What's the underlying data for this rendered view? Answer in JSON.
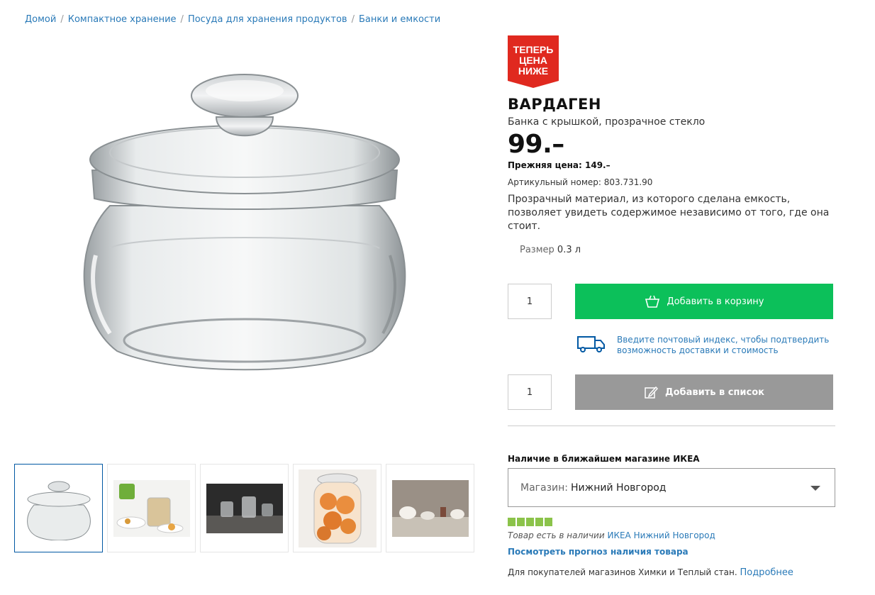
{
  "breadcrumb": [
    "Домой",
    "Компактное хранение",
    "Посуда для хранения продуктов",
    "Банки и емкости"
  ],
  "badge": {
    "line1": "ТЕПЕРЬ",
    "line2": "ЦЕНА",
    "line3": "НИЖЕ",
    "color": "#e0291f"
  },
  "product": {
    "name": "ВАРДАГЕН",
    "description": "Банка с крышкой, прозрачное стекло",
    "price": "99.–",
    "old_price": "Прежняя цена: 149.–",
    "article": "Артикульный номер: 803.731.90",
    "long_description": "Прозрачный материал, из которого сделана емкость, позволяет увидеть содержимое независимо от того, где она стоит.",
    "size_label": "Размер",
    "size_value": "0.3 л"
  },
  "cart": {
    "quantity": "1",
    "add_to_cart": "Добавить в корзину",
    "color": "#0cc05a"
  },
  "delivery": {
    "text": "Введите почтовый индекс, чтобы подтвердить возможность доставки и стоимость"
  },
  "list": {
    "quantity": "1",
    "add_to_list": "Добавить в список"
  },
  "availability": {
    "title": "Наличие в ближайшем магазине ИКЕА",
    "store_label": "Магазин:",
    "store_value": "Нижний Новгород",
    "stock_level": 5,
    "stock_text": "Товар есть в наличии",
    "stock_store": "ИКЕА Нижний Новгород",
    "forecast_link": "Посмотреть прогноз наличия товара",
    "note": "Для покупателей магазинов Химки и Теплый стан.",
    "note_link": "Подробнее"
  }
}
